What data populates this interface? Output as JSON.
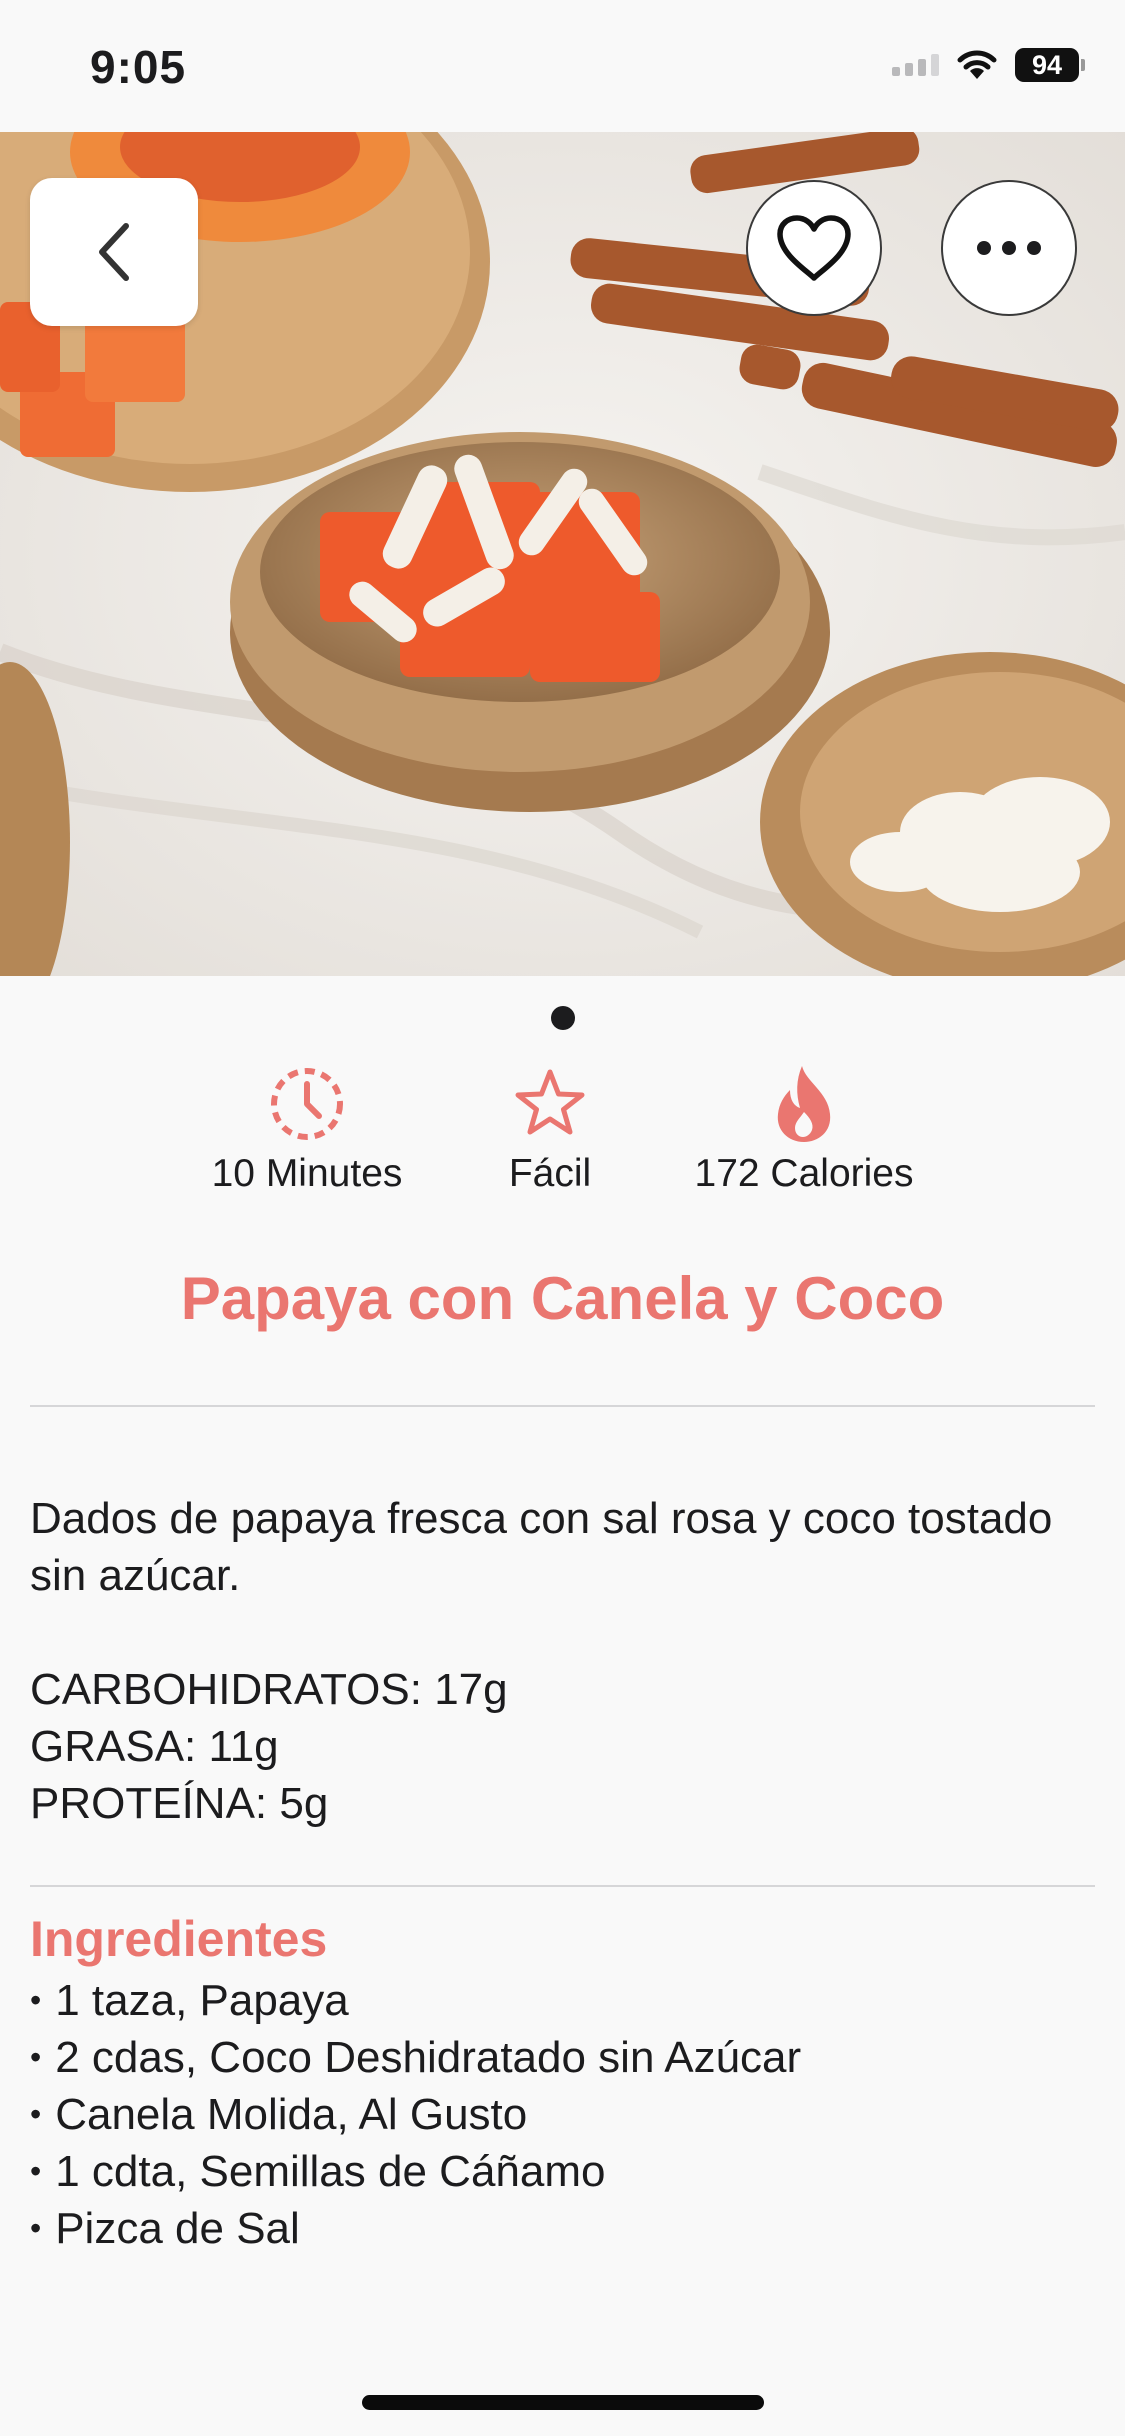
{
  "status_bar": {
    "time": "9:05",
    "battery": "94",
    "icons": [
      "signal-icon",
      "wifi-icon",
      "battery-icon"
    ]
  },
  "hero": {
    "image": "papaya-cinnamon-coconut-photo",
    "actions": [
      "back-icon",
      "heart-icon",
      "more-icon"
    ],
    "page_count": 1,
    "current_page": 1
  },
  "stats": {
    "time": {
      "icon": "clock-icon",
      "label": "10 Minutes"
    },
    "difficulty": {
      "icon": "star-icon",
      "label": "Fácil"
    },
    "calories": {
      "icon": "flame-icon",
      "label": "172 Calories"
    }
  },
  "recipe": {
    "title": "Papaya con Canela y Coco",
    "description": "Dados de papaya fresca con sal rosa y coco tostado sin azúcar.",
    "macros": [
      "CARBOHIDRATOS: 17g",
      "GRASA: 11g",
      "PROTEÍNA: 5g"
    ],
    "ingredients_title": "Ingredientes",
    "ingredients": [
      "1 taza, Papaya",
      "2 cdas, Coco Deshidratado sin Azúcar",
      "Canela Molida, Al Gusto",
      "1 cdta, Semillas de Cáñamo",
      "Pizca de Sal"
    ]
  },
  "colors": {
    "accent": "#ea7670",
    "background": "#f9f9f9",
    "text": "#1c1c1e"
  }
}
